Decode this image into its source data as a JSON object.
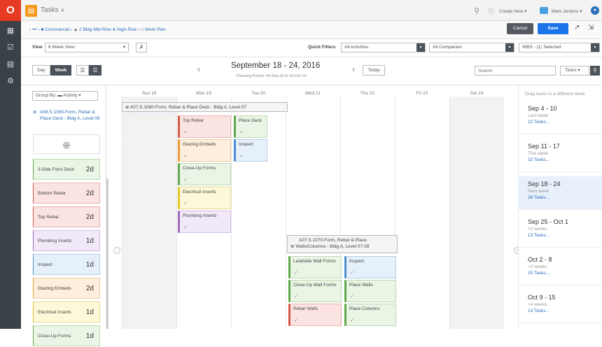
{
  "top": {
    "app": "Tasks",
    "create_new": "Create New",
    "user": "Mark Jenkins"
  },
  "breadcrumb": {
    "sep": "›",
    "more": "•••",
    "project": "Commercial",
    "building": "2 Bldg Mid-Rise & High-Rise",
    "plan": "Work Plan"
  },
  "actions": {
    "cancel": "Cancel",
    "save": "Save"
  },
  "view": {
    "label": "View",
    "value": "6 Week View",
    "quick_filters": "Quick Filters",
    "activities": "All Activities",
    "companies": "All Companies",
    "wbs": "WBS - (1) Selected"
  },
  "toolbar": {
    "day": "Day",
    "week": "Week",
    "date_range": "September 18 - 24, 2016",
    "planning_period": "Planning Period: 04-Sep-16 to 15-Oct-16",
    "today": "Today",
    "search_placeholder": "Search",
    "tasks": "Tasks"
  },
  "group_by": "Group By: ▬ Activity",
  "sidebar_group": "A08.S.1060-Form, Rebar & Place Deck - Bldg A, Level 08",
  "activities": [
    {
      "name": "3-Side Form Deck",
      "dur": "2d",
      "color": "green"
    },
    {
      "name": "Bottom Rebar",
      "dur": "2d",
      "color": "red"
    },
    {
      "name": "Top Rebar",
      "dur": "2d",
      "color": "red"
    },
    {
      "name": "Plumbing Inserts",
      "dur": "1d",
      "color": "purple"
    },
    {
      "name": "Inspect",
      "dur": "1d",
      "color": "blue"
    },
    {
      "name": "Glazing Embeds",
      "dur": "2d",
      "color": "orange"
    },
    {
      "name": "Electrical Inserts",
      "dur": "1d",
      "color": "yellow"
    },
    {
      "name": "Close-Up Forms",
      "dur": "1d",
      "color": "green"
    }
  ],
  "days": [
    "Sun 18",
    "Mon 19",
    "Tue 20",
    "Wed 21",
    "Thu 22",
    "Fri 23",
    "Sat 24"
  ],
  "group1": "A07.S.1060-Form, Rebar & Place Deck - Bldg A, Level 07",
  "group2_l1": "A07.S.1070-Form, Rebar & Place",
  "group2_l2": "Walls/Columns - Bldg A, Level 07-08",
  "tasks": {
    "top_rebar": "Top Rebar",
    "place_deck": "Place Deck",
    "glazing": "Glazing Embeds",
    "inspect": "Inspect",
    "closeup": "Close-Up Forms",
    "electrical": "Electrical Inserts",
    "plumbing": "Plumbing Inserts",
    "leadside": "Leadside Wall Forms",
    "inspect2": "Inspect",
    "closeup_wall": "Close-Up Wall Forms",
    "place_walls": "Place Walls",
    "rebar_walls": "Rebar Walls",
    "place_columns": "Place Columns"
  },
  "weeks_hint": "Drag tasks to a different week",
  "weeks": [
    {
      "range": "Sep 4 - 10",
      "sub": "Last week",
      "count": "22 Tasks..."
    },
    {
      "range": "Sep 11 - 17",
      "sub": "This week",
      "count": "32 Tasks..."
    },
    {
      "range": "Sep 18 - 24",
      "sub": "Next week",
      "count": "36 Tasks..."
    },
    {
      "range": "Sep 25 - Oct 1",
      "sub": "+2 weeks",
      "count": "13 Tasks..."
    },
    {
      "range": "Oct 2 - 8",
      "sub": "+3 weeks",
      "count": "15 Tasks..."
    },
    {
      "range": "Oct 9 - 15",
      "sub": "+4 weeks",
      "count": "13 Tasks..."
    }
  ],
  "colors": {
    "brand": "#e63a22",
    "save": "#1a73e8",
    "rail": "#3b4149"
  }
}
